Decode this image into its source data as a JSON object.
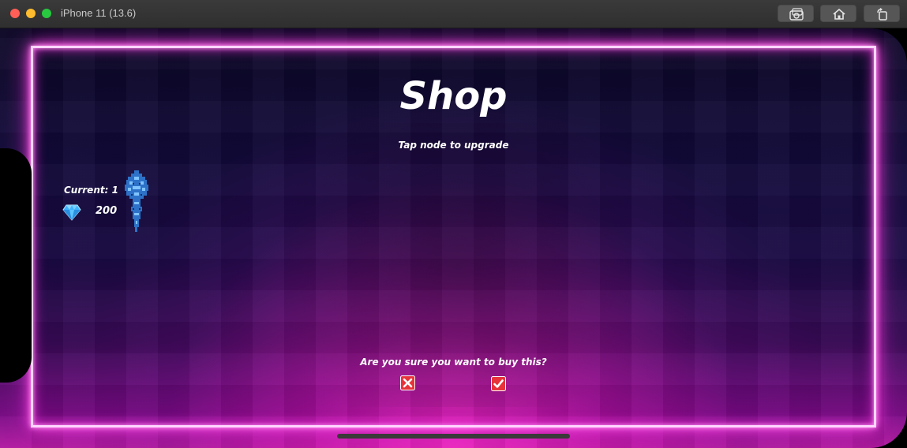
{
  "window": {
    "title": "iPhone 11 (13.6)",
    "buttons": [
      "screenshot-icon",
      "home-icon",
      "rotate-icon"
    ]
  },
  "game": {
    "title": "Shop",
    "subtitle": "Tap node to upgrade",
    "current_label": "Current: 1",
    "gem_count": "200",
    "confirm_question": "Are you sure you want to buy this?"
  },
  "colors": {
    "neon_frame": "#ffd6ff",
    "neon_glow": "#e02bd0",
    "cancel_red": "#e8333a",
    "confirm_red": "#e8333a",
    "gem_blue": "#47b9ff"
  }
}
